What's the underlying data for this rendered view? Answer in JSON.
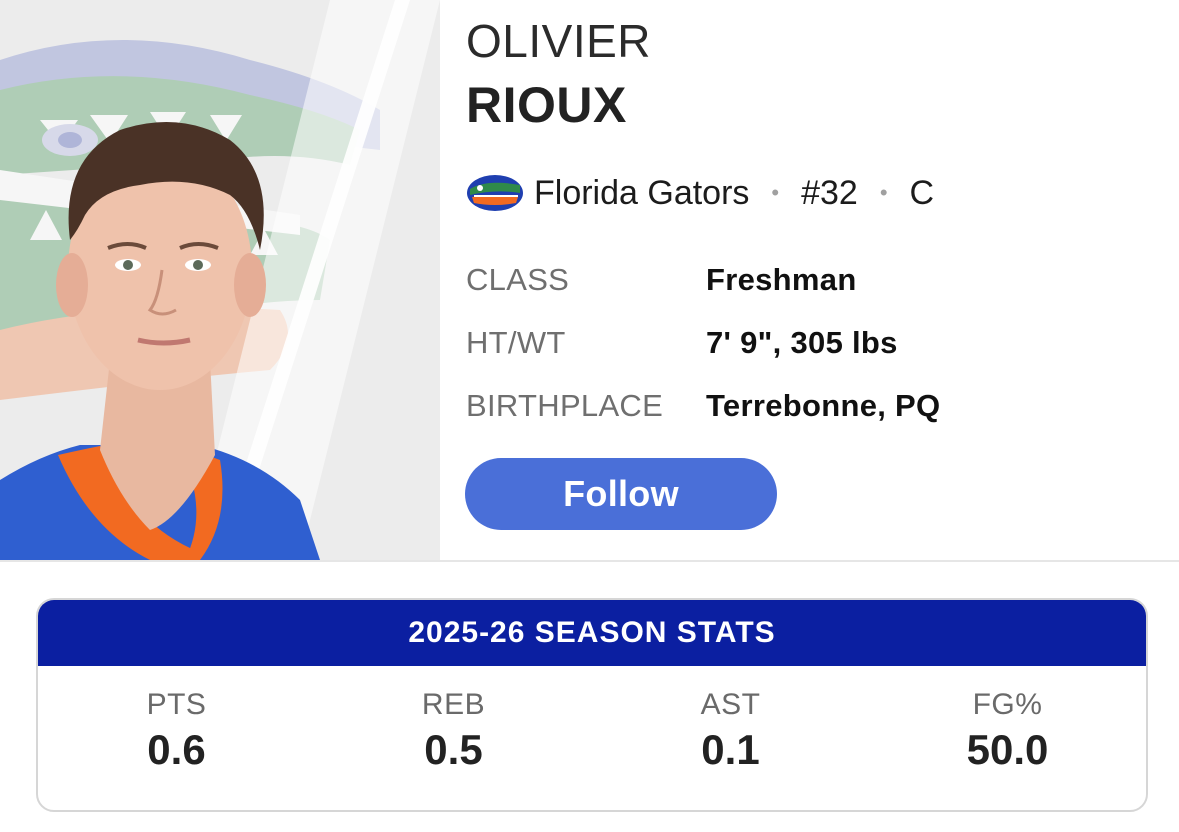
{
  "player": {
    "first_name": "OLIVIER",
    "last_name": "RIOUX",
    "team": "Florida Gators",
    "number": "#32",
    "position": "C",
    "separator": "•"
  },
  "info": [
    {
      "label": "CLASS",
      "value": "Freshman"
    },
    {
      "label": "HT/WT",
      "value": "7' 9\", 305 lbs"
    },
    {
      "label": "BIRTHPLACE",
      "value": "Terrebonne, PQ"
    }
  ],
  "follow_label": "Follow",
  "stats": {
    "title": "2025-26 SEASON STATS",
    "items": [
      {
        "label": "PTS",
        "value": "0.6"
      },
      {
        "label": "REB",
        "value": "0.5"
      },
      {
        "label": "AST",
        "value": "0.1"
      },
      {
        "label": "FG%",
        "value": "50.0"
      }
    ]
  },
  "colors": {
    "team_blue": "#0b1fa1",
    "button_blue": "#4a6fd8",
    "team_orange": "#f26a21",
    "gator_green": "#5a9a6a"
  },
  "icons": {
    "team_logo": "florida-gators-logo",
    "headshot": "player-headshot"
  }
}
